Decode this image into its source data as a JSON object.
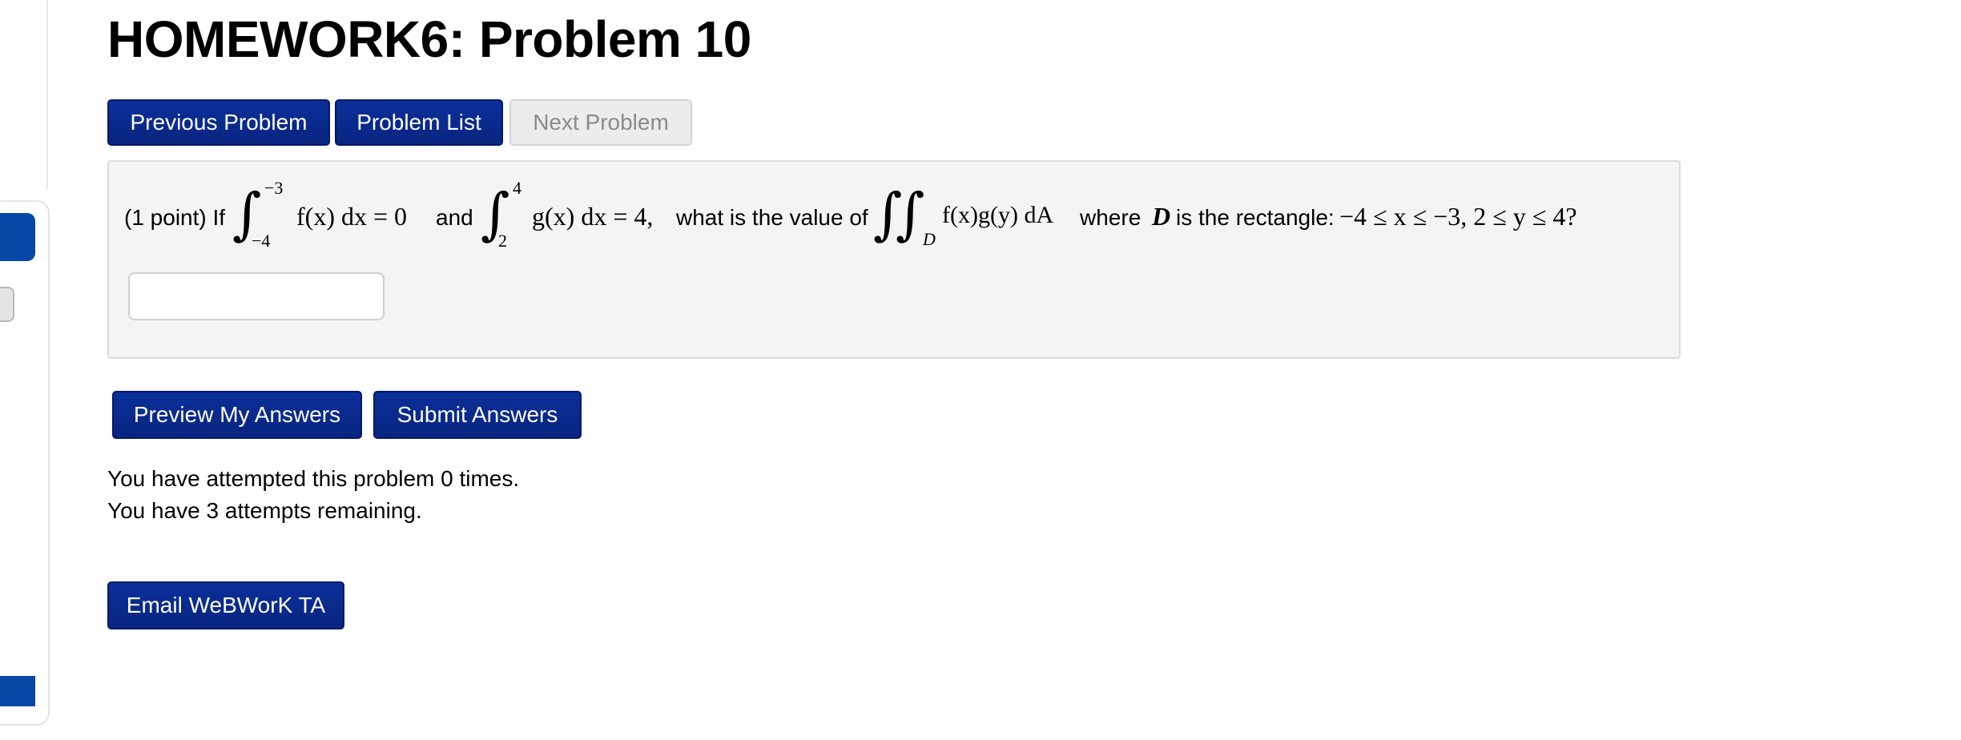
{
  "page": {
    "title": "HOMEWORK6: Problem 10"
  },
  "nav": {
    "previous_label": "Previous Problem",
    "list_label": "Problem List",
    "next_label": "Next Problem"
  },
  "problem": {
    "points_prefix": "(1 point) If",
    "integral1": {
      "upper": "−3",
      "lower": "−4",
      "integrand": "f(x) dx = 0"
    },
    "and_text": "and",
    "integral2": {
      "upper": "4",
      "lower": "2",
      "integrand": "g(x) dx = 4,"
    },
    "question_text": "what is the value of",
    "double_integral": {
      "region": "D",
      "integrand": "f(x)g(y) dA"
    },
    "where_text": "where",
    "region_var": "D",
    "rect_text": "is the rectangle:",
    "inequality": "−4 ≤ x ≤ −3,  2 ≤ y ≤ 4?"
  },
  "answer": {
    "value": "",
    "placeholder": ""
  },
  "actions": {
    "preview_label": "Preview My Answers",
    "submit_label": "Submit Answers"
  },
  "status": {
    "attempted": "You have attempted this problem 0 times.",
    "remaining": "You have 3 attempts remaining."
  },
  "email": {
    "label": "Email WeBWorK TA"
  },
  "colors": {
    "primary_button": "#0a2a8f",
    "sidebar_accent": "#0747a6",
    "problem_background": "#f4f4f4"
  }
}
